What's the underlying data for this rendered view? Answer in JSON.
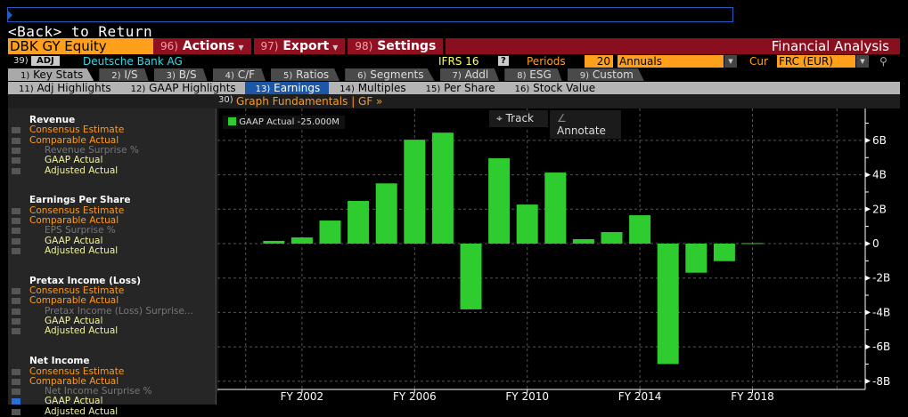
{
  "command": {
    "back_text": "<Back> to Return"
  },
  "header": {
    "ticker": "DBK GY Equity",
    "actions": {
      "num": "96)",
      "label": "Actions"
    },
    "export": {
      "num": "97)",
      "label": "Export"
    },
    "settings": {
      "num": "98)",
      "label": "Settings"
    },
    "title": "Financial Analysis"
  },
  "info": {
    "num": "39)",
    "adj": "ADJ",
    "company": "Deutsche Bank AG",
    "ifrs": "IFRS 16",
    "help": "?",
    "periods_label": "Periods",
    "periods": "20",
    "period_type": "Annuals",
    "cur_label": "Cur",
    "currency": "FRC (EUR)"
  },
  "tabs": [
    {
      "n": "1)",
      "l": "Key Stats"
    },
    {
      "n": "2)",
      "l": "I/S"
    },
    {
      "n": "3)",
      "l": "B/S"
    },
    {
      "n": "4)",
      "l": "C/F"
    },
    {
      "n": "5)",
      "l": "Ratios"
    },
    {
      "n": "6)",
      "l": "Segments"
    },
    {
      "n": "7)",
      "l": "Addl"
    },
    {
      "n": "8)",
      "l": "ESG"
    },
    {
      "n": "9)",
      "l": "Custom"
    }
  ],
  "subtabs": [
    {
      "n": "11)",
      "l": "Adj Highlights"
    },
    {
      "n": "12)",
      "l": "GAAP Highlights"
    },
    {
      "n": "13)",
      "l": "Earnings"
    },
    {
      "n": "14)",
      "l": "Multiples"
    },
    {
      "n": "15)",
      "l": "Per Share"
    },
    {
      "n": "16)",
      "l": "Stock Value"
    }
  ],
  "graph_link": {
    "num": "30)",
    "label": "Graph Fundamentals | GF »"
  },
  "sidebar": [
    {
      "title": "Revenue",
      "items": [
        "Consensus Estimate",
        "Comparable Actual",
        "Revenue Surprise %",
        "GAAP Actual",
        "Adjusted Actual"
      ]
    },
    {
      "title": "Earnings Per Share",
      "items": [
        "Consensus Estimate",
        "Comparable Actual",
        "EPS Surprise %",
        "GAAP Actual",
        "Adjusted Actual"
      ]
    },
    {
      "title": "Pretax Income (Loss)",
      "items": [
        "Consensus Estimate",
        "Comparable Actual",
        "Pretax Income (Loss) Surprise...",
        "GAAP Actual",
        "Adjusted Actual"
      ]
    },
    {
      "title": "Net Income",
      "items": [
        "Consensus Estimate",
        "Comparable Actual",
        "Net Income Surprise %",
        "GAAP Actual",
        "Adjusted Actual"
      ]
    }
  ],
  "toolbar": {
    "track": "Track",
    "annotate": "Annotate"
  },
  "colors": {
    "bar": "#2ecc2e",
    "orange": "#ffa01c",
    "red": "#8a0f1e"
  },
  "chart_data": {
    "type": "bar",
    "legend": {
      "label": "GAAP Actual",
      "value": "-25.000M",
      "position": "top-left"
    },
    "x": [
      2001,
      2002,
      2003,
      2004,
      2005,
      2006,
      2007,
      2008,
      2009,
      2010,
      2011,
      2012,
      2013,
      2014,
      2015,
      2016,
      2017,
      2018
    ],
    "values": [
      0.16,
      0.36,
      1.34,
      2.48,
      3.5,
      6.04,
      6.45,
      -3.82,
      4.96,
      2.27,
      4.13,
      0.26,
      0.67,
      1.65,
      -7.0,
      -1.69,
      -1.02,
      0.03
    ],
    "unit": "B EUR",
    "xticks": [
      "FY 2002",
      "FY 2006",
      "FY 2010",
      "FY 2014",
      "FY 2018"
    ],
    "yticks": [
      "6B",
      "4B",
      "2B",
      "0",
      "-2B",
      "-4B",
      "-6B",
      "-8B"
    ],
    "ylim": [
      -8.2,
      7.5
    ],
    "grid": true
  }
}
